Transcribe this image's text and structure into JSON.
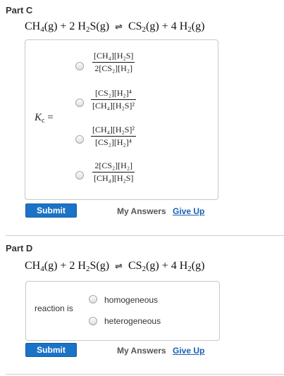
{
  "partC": {
    "title": "Part C",
    "equation": {
      "r1_a": "CH",
      "r1_b": "4",
      "r1_c": "(g) + 2 H",
      "r2_a": "2",
      "r2_b": "S(g)",
      "p1_a": "CS",
      "p1_b": "2",
      "p1_c": "(g) + 4 H",
      "p2_a": "2",
      "p2_b": "(g)",
      "arrow": "⇌"
    },
    "kc_symbol": "K",
    "kc_sub": "c",
    "kc_eq": " =",
    "options": [
      {
        "num": "[CH₄][H₂S]",
        "den": "2[CS₂][H₂]"
      },
      {
        "num": "[CS₂][H₂]⁴",
        "den": "[CH₄][H₂S]²"
      },
      {
        "num": "[CH₄][H₂S]²",
        "den": "[CS₂][H₂]⁴"
      },
      {
        "num": "2[CS₂][H₂]",
        "den": "[CH₄][H₂S]"
      }
    ],
    "submit": "Submit",
    "my_answers": "My Answers",
    "give_up": "Give Up"
  },
  "partD": {
    "title": "Part D",
    "reaction_is": "reaction is",
    "options": [
      "homogeneous",
      "heterogeneous"
    ],
    "submit": "Submit",
    "my_answers": "My Answers",
    "give_up": "Give Up"
  }
}
